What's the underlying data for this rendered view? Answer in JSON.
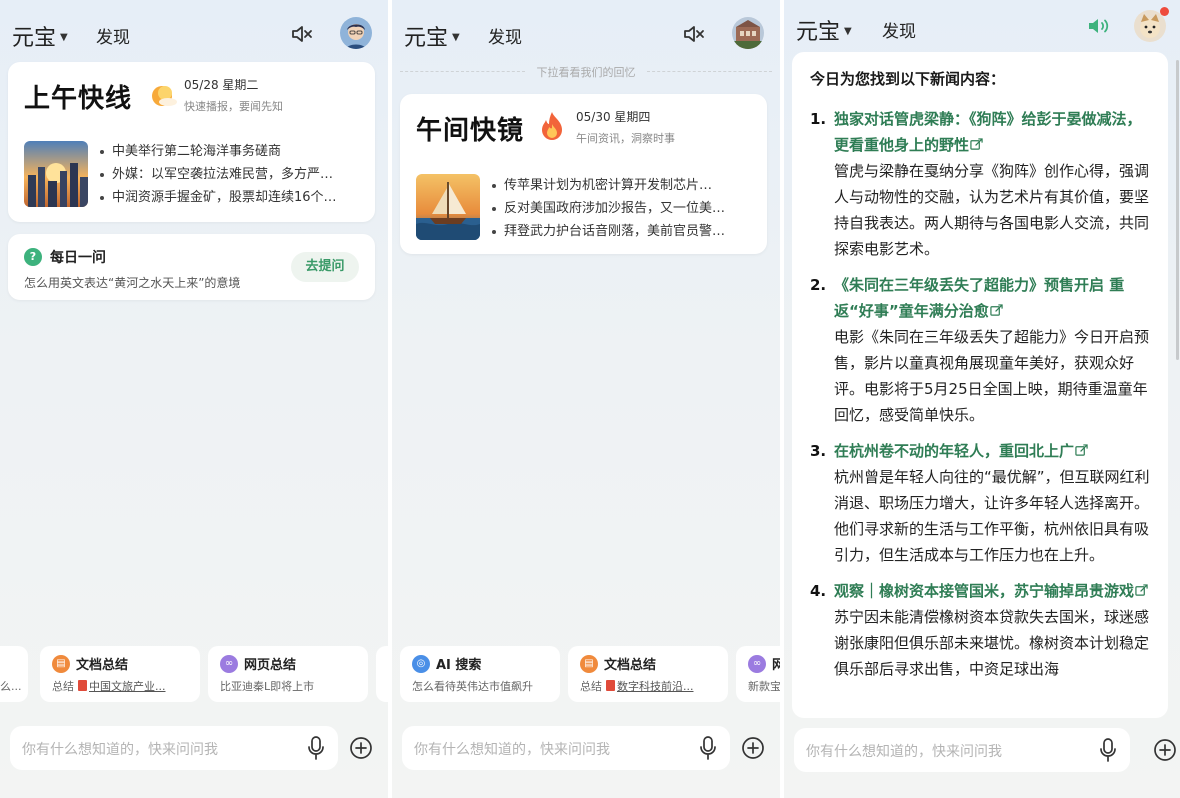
{
  "common": {
    "brand": "元宝",
    "discover": "发现",
    "input_placeholder": "你有什么想知道的，快来问问我"
  },
  "panel1": {
    "brief": {
      "title": "上午快线",
      "date": "05/28 星期二",
      "subtitle": "快速播报，要闻先知",
      "items": [
        "中美举行第二轮海洋事务磋商",
        "外媒：以军空袭拉法难民营，多方严…",
        "中润资源手握金矿，股票却连续16个…"
      ]
    },
    "daily": {
      "icon": "?",
      "title": "每日一问",
      "question": "怎么用英文表达“黄河之水天上来”的意境",
      "button": "去提问"
    },
    "chips": [
      {
        "title": "",
        "sub": "么..."
      },
      {
        "title": "文档总结",
        "sub_prefix": "总结",
        "doc": "中国文旅产业..."
      },
      {
        "title": "网页总结",
        "sub": "比亚迪秦L即将上市"
      }
    ]
  },
  "panel2": {
    "pull_hint": "下拉看看我们的回忆",
    "brief": {
      "title": "午间快镜",
      "date": "05/30 星期四",
      "subtitle": "午间资讯，洞察时事",
      "items": [
        "传苹果计划为机密计算开发制芯片…",
        "反对美国政府涉加沙报告，又一位美…",
        "拜登武力护台话音刚落，美前官员警…"
      ]
    },
    "chips": [
      {
        "title": "AI 搜索",
        "sub": "怎么看待英伟达市值飙升"
      },
      {
        "title": "文档总结",
        "sub_prefix": "总结",
        "doc": "数字科技前沿..."
      },
      {
        "title": "网",
        "sub": "新款宝"
      }
    ]
  },
  "panel3": {
    "intro": "今日为您找到以下新闻内容：",
    "items": [
      {
        "num": "1.",
        "title": "独家对话管虎梁静：《狗阵》给彭于晏做减法，更看重他身上的野性",
        "body": "管虎与梁静在戛纳分享《狗阵》创作心得，强调人与动物性的交融，认为艺术片有其价值，要坚持自我表达。两人期待与各国电影人交流，共同探索电影艺术。"
      },
      {
        "num": "2.",
        "title": "《朱同在三年级丢失了超能力》预售开启 重返“好事”童年满分治愈",
        "body": "电影《朱同在三年级丢失了超能力》今日开启预售，影片以童真视角展现童年美好，获观众好评。电影将于5月25日全国上映，期待重温童年回忆，感受简单快乐。"
      },
      {
        "num": "3.",
        "title": "在杭州卷不动的年轻人，重回北上广",
        "body": "杭州曾是年轻人向往的“最优解”，但互联网红利消退、职场压力增大，让许多年轻人选择离开。他们寻求新的生活与工作平衡，杭州依旧具有吸引力，但生活成本与工作压力也在上升。"
      },
      {
        "num": "4.",
        "title": "观察｜橡树资本接管国米，苏宁输掉昂贵游戏",
        "body": "苏宁因未能清偿橡树资本贷款失去国米，球迷感谢张康阳但俱乐部未来堪忧。橡树资本计划稳定俱乐部后寻求出售，中资足球出海"
      }
    ]
  },
  "colors": {
    "accent_green": "#2f7d55",
    "sound_on": "#3db27d"
  }
}
